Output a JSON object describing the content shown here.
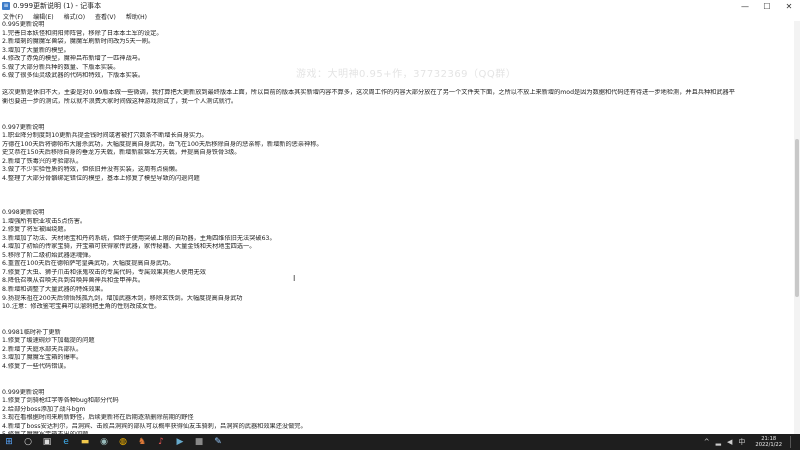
{
  "window": {
    "title": "0.999更新说明 (1) - 记事本",
    "minimize": "—",
    "maximize": "☐",
    "close": "✕"
  },
  "menu": [
    "文件(F)",
    "编辑(E)",
    "格式(O)",
    "查看(V)",
    "帮助(H)"
  ],
  "watermark": "游戏：大明神0.95+作，37732369（QQ群）",
  "lines": [
    "0.995更新说明",
    "1.完善日本妖怪和阴阳师阵营，移除了日本本土军的设定。",
    "2.新增剩的魔魔军兽袋，魔魔军刷新时间改为5天一刷。",
    "3.增加了大量新的模型。",
    "4.修改了赤兔的模型，魔神吕布新增了一匹神战马。",
    "5.做了大部分新兵种的数量、下版本实装。",
    "6.做了很多仙灵级武器的代码和特效，下版本实装。",
    "",
    "这次更新是休旧不大，主要是对0.99版本做一些微调，我打算把大更新放到最终版本上面，所以目前的版本其实新增内容不算多，这次周工作的内容大部分放在了另一个文件夹下面，之所以不放上来新增的mod是因为数据和代码还有待进一步地检测，并且兵种和武器平",
    "衡也要进一步的测试，所以就不浪费大家时间做这种游戏测试了，我一个人测试就行。",
    "",
    "",
    "0.997更新说明",
    "1.职业降分制度到10更新兵提金钱时间或者被打穴数条不断增长自身实力。",
    "方德在100天后将德帕布大屠杀武功，大幅度提高自身武功，岳飞在100天后移除自身的惩亲称，新增新的惩亲神称。",
    "史艾恭在150天后移除自身的垂龙方天戟，新增新款锦军方天戟，并提高自身铁骨3级。",
    "2.新增了铁毒兴的考验部队。",
    "3.做了不少实验性质的特效，但依旧并没有实装，这周有点偷懒。",
    "4.整理了大部分骨骼绑定错位的模型，基本上修复了模型导致的闪退问题",
    "",
    "",
    "",
    "0.998更新说明",
    "1.增强所有职业攻击5点伤害。",
    "2.修复了将军被围绕题。",
    "3.新增加了功法、天材地宝和丹药系统，但终于使用突破上限的自功器，主角四维依旧无法突破63。",
    "4.增加了初始的传家宝骑，开宝箱可获得家传武器，家传秘籍、大量金钱和天材地宝四选一。",
    "5.移除了阶二级初始武器迷魂弹。",
    "6.重置在100天后在德帕萨宅皇典武功，大幅度提高自身武功。",
    "7.修复了大虫、狮子爪击和张鬼攻击的专属代码，专属效果其他人使用无效",
    "8.降低召唤从召唤天兵到召唤异兽神兵和金甲神兵。",
    "8.新增和调整了大量武器的特殊效果。",
    "9.扬提朱祖在200天后领悟残孤九剑，增加武器木剑，移除玄铁剑。大幅度提高自身武功",
    "10.注意：修改鉴宅宝典可以溜刺把主角的性别改成女性。",
    "",
    "",
    "0.9981临时补丁更新",
    "1.修复了缓速碗炒下加载提的问题",
    "2.新增了天庭水部天兵部队。",
    "3.增加了魔魔军宝箱的爆率。",
    "4.修复了一些代码错误。",
    "",
    "",
    "0.999更新说明",
    "1.修复了剑骑枪红字等各种bug和部分代码",
    "2.给部分boss添加了战斗bgm",
    "3.现在看根据时间来刷新野怪，后续更新将在后期逐渐删除前期的野怪",
    "4.新增了boss安达利尔，吕洞宾、击败吕洞宾的部队可以概率获得仙友玉骑刺，吕洞宾的武器和效果还没做完。",
    "5.修复了魔魔军宝箱不出的问题",
    "6.新增了第一主线：金辽之战的部分剧情，后续剧情还待补充。",
    "7.新增了关羽率领的天庭降魔军。"
  ],
  "taskbar": {
    "icons": [
      "windows-start-icon",
      "search-icon",
      "task-view-icon",
      "edge-browser-icon",
      "file-explorer-icon",
      "steam-icon",
      "chrome-icon",
      "game-icon",
      "music-icon",
      "video-icon",
      "app-icon",
      "notepad-icon"
    ],
    "time": "21:18",
    "date": "2022/1/22"
  }
}
